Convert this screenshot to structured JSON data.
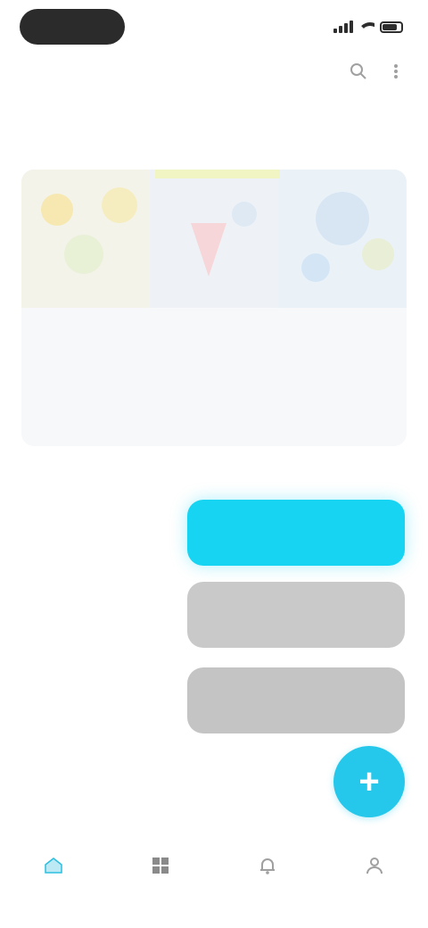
{
  "status_bar": {
    "time": "",
    "battery_level": 0.8
  },
  "header": {
    "actions": [
      {
        "icon": "search-icon"
      },
      {
        "icon": "more-icon"
      }
    ]
  },
  "section": {
    "title": ""
  },
  "card": {
    "title": "",
    "lines": [
      "",
      ""
    ]
  },
  "buttons": {
    "primary_label": "",
    "secondary_label": "",
    "tertiary_label": ""
  },
  "fab": {
    "icon": "plus-icon",
    "label": "+"
  },
  "bottom_nav": {
    "items": [
      {
        "icon": "home-icon",
        "label": "",
        "active": true
      },
      {
        "icon": "grid-icon",
        "label": "",
        "active": false
      },
      {
        "icon": "bell-icon",
        "label": "",
        "active": false
      },
      {
        "icon": "profile-icon",
        "label": "",
        "active": false
      }
    ]
  },
  "colors": {
    "accent": "#17d4f3",
    "fab": "#25c8ea",
    "button_gray": "#c9c9c9",
    "card_bg": "#f7f8fa"
  }
}
